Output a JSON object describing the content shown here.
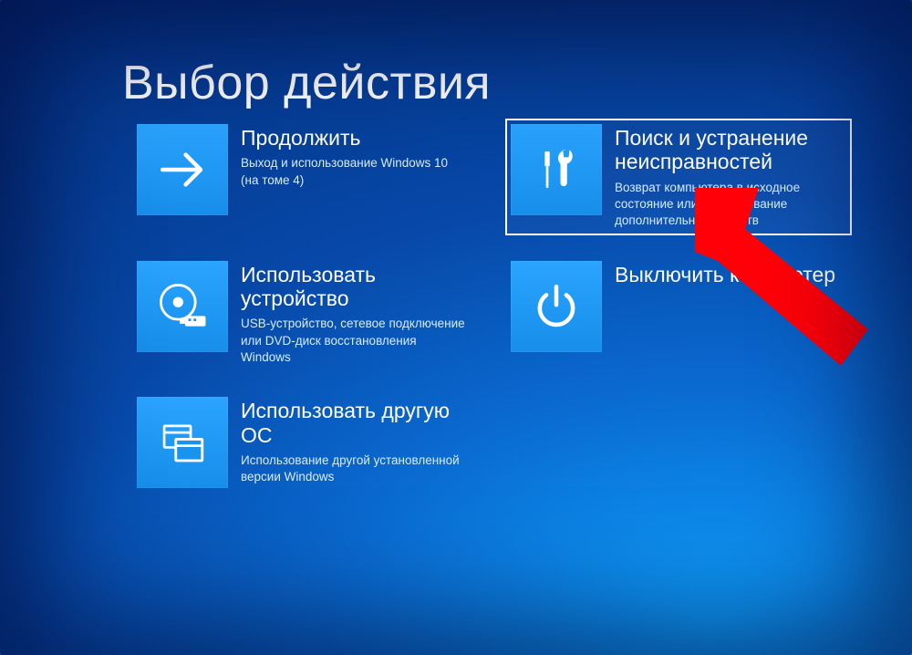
{
  "title": "Выбор действия",
  "tiles": {
    "continue": {
      "title": "Продолжить",
      "desc": "Выход и использование Windows 10 (на томе 4)"
    },
    "troubleshoot": {
      "title": "Поиск и устранение неисправностей",
      "desc": "Возврат компьютера в исходное состояние или использование дополнительных средств"
    },
    "use_device": {
      "title": "Использовать устройство",
      "desc": "USB-устройство, сетевое подключение или DVD-диск восстановления Windows"
    },
    "shutdown": {
      "title": "Выключить компьютер",
      "desc": ""
    },
    "use_other_os": {
      "title": "Использовать другую ОС",
      "desc": "Использование другой установленной версии Windows"
    }
  },
  "selected_tile": "troubleshoot",
  "colors": {
    "tile_bg": "#1a93ee",
    "accent_arrow": "#ff0008"
  }
}
